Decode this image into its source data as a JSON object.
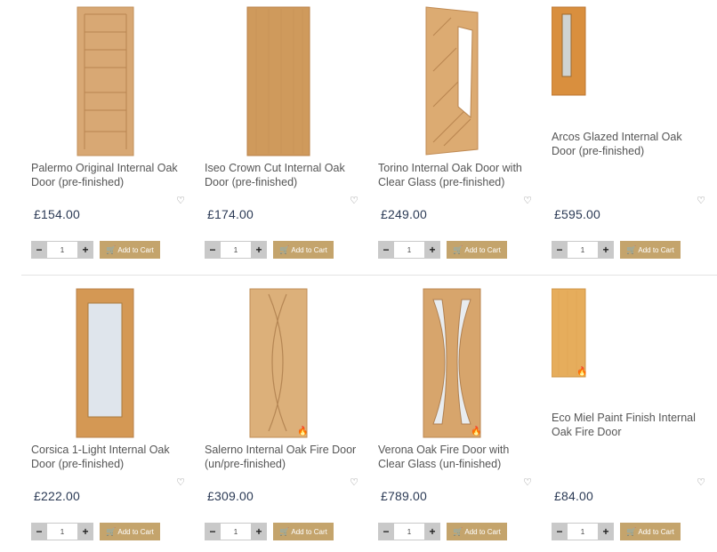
{
  "products": [
    {
      "title": "Palermo Original Internal Oak Door (pre-finished)",
      "price": "£154.00",
      "qty": "1",
      "cart_label": "Add to Cart"
    },
    {
      "title": "Iseo Crown Cut Internal Oak Door (pre-finished)",
      "price": "£174.00",
      "qty": "1",
      "cart_label": "Add to Cart"
    },
    {
      "title": "Torino Internal Oak Door with Clear Glass (pre-finished)",
      "price": "£249.00",
      "qty": "1",
      "cart_label": "Add to Cart"
    },
    {
      "title": "Arcos Glazed Internal Oak Door (pre-finished)",
      "price": "£595.00",
      "qty": "1",
      "cart_label": "Add to Cart"
    },
    {
      "title": "Corsica 1-Light Internal Oak Door (pre-finished)",
      "price": "£222.00",
      "qty": "1",
      "cart_label": "Add to Cart"
    },
    {
      "title": "Salerno Internal Oak Fire Door (un/pre-finished)",
      "price": "£309.00",
      "qty": "1",
      "cart_label": "Add to Cart"
    },
    {
      "title": "Verona Oak Fire Door with Clear Glass (un-finished)",
      "price": "£789.00",
      "qty": "1",
      "cart_label": "Add to Cart"
    },
    {
      "title": "Eco Miel Paint Finish Internal Oak Fire Door",
      "price": "£84.00",
      "qty": "1",
      "cart_label": "Add to Cart"
    }
  ],
  "icons": {
    "heart": "heart-icon",
    "cart": "cart-icon",
    "fire": "fire-icon"
  },
  "colors": {
    "cart_button": "#c4a46c",
    "price": "#2b3a55",
    "qty_button": "#c9c9c9",
    "oak": "#d9a86a"
  }
}
